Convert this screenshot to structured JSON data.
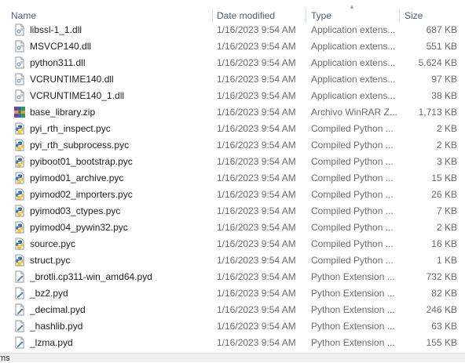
{
  "columns": {
    "name": "Name",
    "date": "Date modified",
    "type": "Type",
    "size": "Size"
  },
  "files": [
    {
      "name": "libssl-1_1.dll",
      "date": "1/16/2023 9:54 AM",
      "type": "Application extens...",
      "size": "687 KB",
      "icon": "dll-file-icon"
    },
    {
      "name": "MSVCP140.dll",
      "date": "1/16/2023 9:54 AM",
      "type": "Application extens...",
      "size": "551 KB",
      "icon": "dll-file-icon"
    },
    {
      "name": "python311.dll",
      "date": "1/16/2023 9:54 AM",
      "type": "Application extens...",
      "size": "5,624 KB",
      "icon": "dll-file-icon"
    },
    {
      "name": "VCRUNTIME140.dll",
      "date": "1/16/2023 9:54 AM",
      "type": "Application extens...",
      "size": "97 KB",
      "icon": "dll-file-icon"
    },
    {
      "name": "VCRUNTIME140_1.dll",
      "date": "1/16/2023 9:54 AM",
      "type": "Application extens...",
      "size": "38 KB",
      "icon": "dll-file-icon"
    },
    {
      "name": "base_library.zip",
      "date": "1/16/2023 9:54 AM",
      "type": "Archivo WinRAR Z...",
      "size": "1,713 KB",
      "icon": "winrar-archive-icon"
    },
    {
      "name": "pyi_rth_inspect.pyc",
      "date": "1/16/2023 9:54 AM",
      "type": "Compiled Python ...",
      "size": "2 KB",
      "icon": "python-compiled-icon"
    },
    {
      "name": "pyi_rth_subprocess.pyc",
      "date": "1/16/2023 9:54 AM",
      "type": "Compiled Python ...",
      "size": "2 KB",
      "icon": "python-compiled-icon"
    },
    {
      "name": "pyiboot01_bootstrap.pyc",
      "date": "1/16/2023 9:54 AM",
      "type": "Compiled Python ...",
      "size": "3 KB",
      "icon": "python-compiled-icon"
    },
    {
      "name": "pyimod01_archive.pyc",
      "date": "1/16/2023 9:54 AM",
      "type": "Compiled Python ...",
      "size": "15 KB",
      "icon": "python-compiled-icon"
    },
    {
      "name": "pyimod02_importers.pyc",
      "date": "1/16/2023 9:54 AM",
      "type": "Compiled Python ...",
      "size": "26 KB",
      "icon": "python-compiled-icon"
    },
    {
      "name": "pyimod03_ctypes.pyc",
      "date": "1/16/2023 9:54 AM",
      "type": "Compiled Python ...",
      "size": "7 KB",
      "icon": "python-compiled-icon"
    },
    {
      "name": "pyimod04_pywin32.pyc",
      "date": "1/16/2023 9:54 AM",
      "type": "Compiled Python ...",
      "size": "2 KB",
      "icon": "python-compiled-icon"
    },
    {
      "name": "source.pyc",
      "date": "1/16/2023 9:54 AM",
      "type": "Compiled Python ...",
      "size": "16 KB",
      "icon": "python-compiled-icon"
    },
    {
      "name": "struct.pyc",
      "date": "1/16/2023 9:54 AM",
      "type": "Compiled Python ...",
      "size": "1 KB",
      "icon": "python-compiled-icon"
    },
    {
      "name": "_brotli.cp311-win_amd64.pyd",
      "date": "1/16/2023 9:54 AM",
      "type": "Python Extension ...",
      "size": "732 KB",
      "icon": "pyd-file-icon"
    },
    {
      "name": "_bz2.pyd",
      "date": "1/16/2023 9:54 AM",
      "type": "Python Extension ...",
      "size": "82 KB",
      "icon": "pyd-file-icon"
    },
    {
      "name": "_decimal.pyd",
      "date": "1/16/2023 9:54 AM",
      "type": "Python Extension ...",
      "size": "246 KB",
      "icon": "pyd-file-icon"
    },
    {
      "name": "_hashlib.pyd",
      "date": "1/16/2023 9:54 AM",
      "type": "Python Extension ...",
      "size": "63 KB",
      "icon": "pyd-file-icon"
    },
    {
      "name": "_lzma.pyd",
      "date": "1/16/2023 9:54 AM",
      "type": "Python Extension ...",
      "size": "155 KB",
      "icon": "pyd-file-icon"
    }
  ],
  "status_bar": {
    "text": "ms"
  }
}
